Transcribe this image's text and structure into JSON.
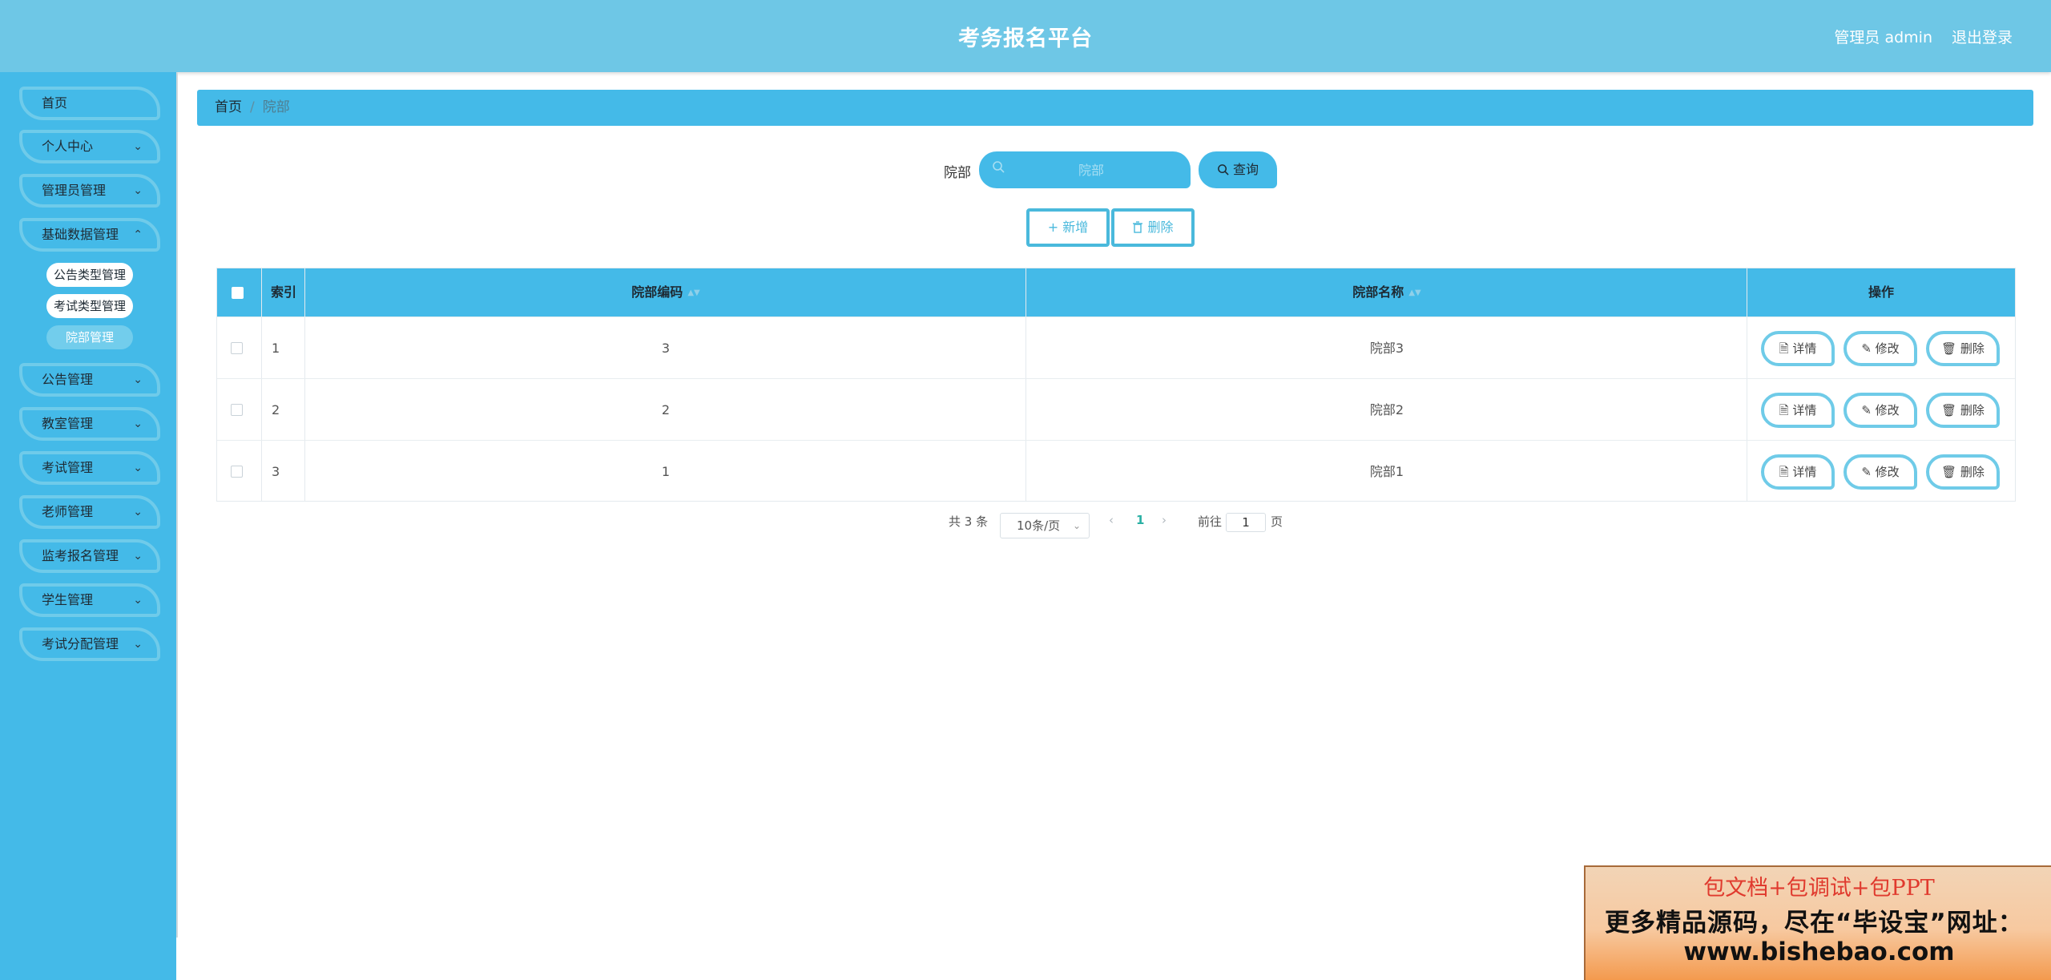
{
  "header": {
    "title": "考务报名平台",
    "user": "管理员 admin",
    "logout": "退出登录"
  },
  "sidebar": {
    "items": [
      {
        "label": "首页",
        "has_children": false
      },
      {
        "label": "个人中心",
        "has_children": true
      },
      {
        "label": "管理员管理",
        "has_children": true
      },
      {
        "label": "基础数据管理",
        "has_children": true
      },
      {
        "label": "公告管理",
        "has_children": true
      },
      {
        "label": "教室管理",
        "has_children": true
      },
      {
        "label": "考试管理",
        "has_children": true
      },
      {
        "label": "老师管理",
        "has_children": true
      },
      {
        "label": "监考报名管理",
        "has_children": true
      },
      {
        "label": "学生管理",
        "has_children": true
      },
      {
        "label": "考试分配管理",
        "has_children": true
      }
    ],
    "sub_items": [
      {
        "label": "公告类型管理",
        "active": false
      },
      {
        "label": "考试类型管理",
        "active": false
      },
      {
        "label": "院部管理",
        "active": true
      }
    ]
  },
  "breadcrumb": {
    "home": "首页",
    "separator": "/",
    "current": "院部"
  },
  "search": {
    "label": "院部",
    "placeholder": "院部",
    "button": "查询"
  },
  "actions": {
    "add": "新增",
    "delete": "删除"
  },
  "table": {
    "headers": {
      "index": "索引",
      "code": "院部编码",
      "name": "院部名称",
      "ops": "操作"
    },
    "rows": [
      {
        "index": "1",
        "code": "3",
        "name": "院部3"
      },
      {
        "index": "2",
        "code": "2",
        "name": "院部2"
      },
      {
        "index": "3",
        "code": "1",
        "name": "院部1"
      }
    ],
    "row_actions": {
      "detail": "详情",
      "edit": "修改",
      "delete": "删除"
    }
  },
  "pagination": {
    "total": "共 3 条",
    "page_size": "10条/页",
    "current_page": "1",
    "goto_prefix": "前往",
    "goto_value": "1",
    "goto_suffix": "页"
  },
  "watermark": {
    "line1": "包文档+包调试+包PPT",
    "line2": "更多精品源码，尽在“毕设宝”网址：",
    "line3": "www.bishebao.com"
  },
  "colors": {
    "header": "#6ec7e6",
    "sidebar": "#44bae8",
    "accent": "#44bae8",
    "pager_active": "#2ab0a4"
  }
}
